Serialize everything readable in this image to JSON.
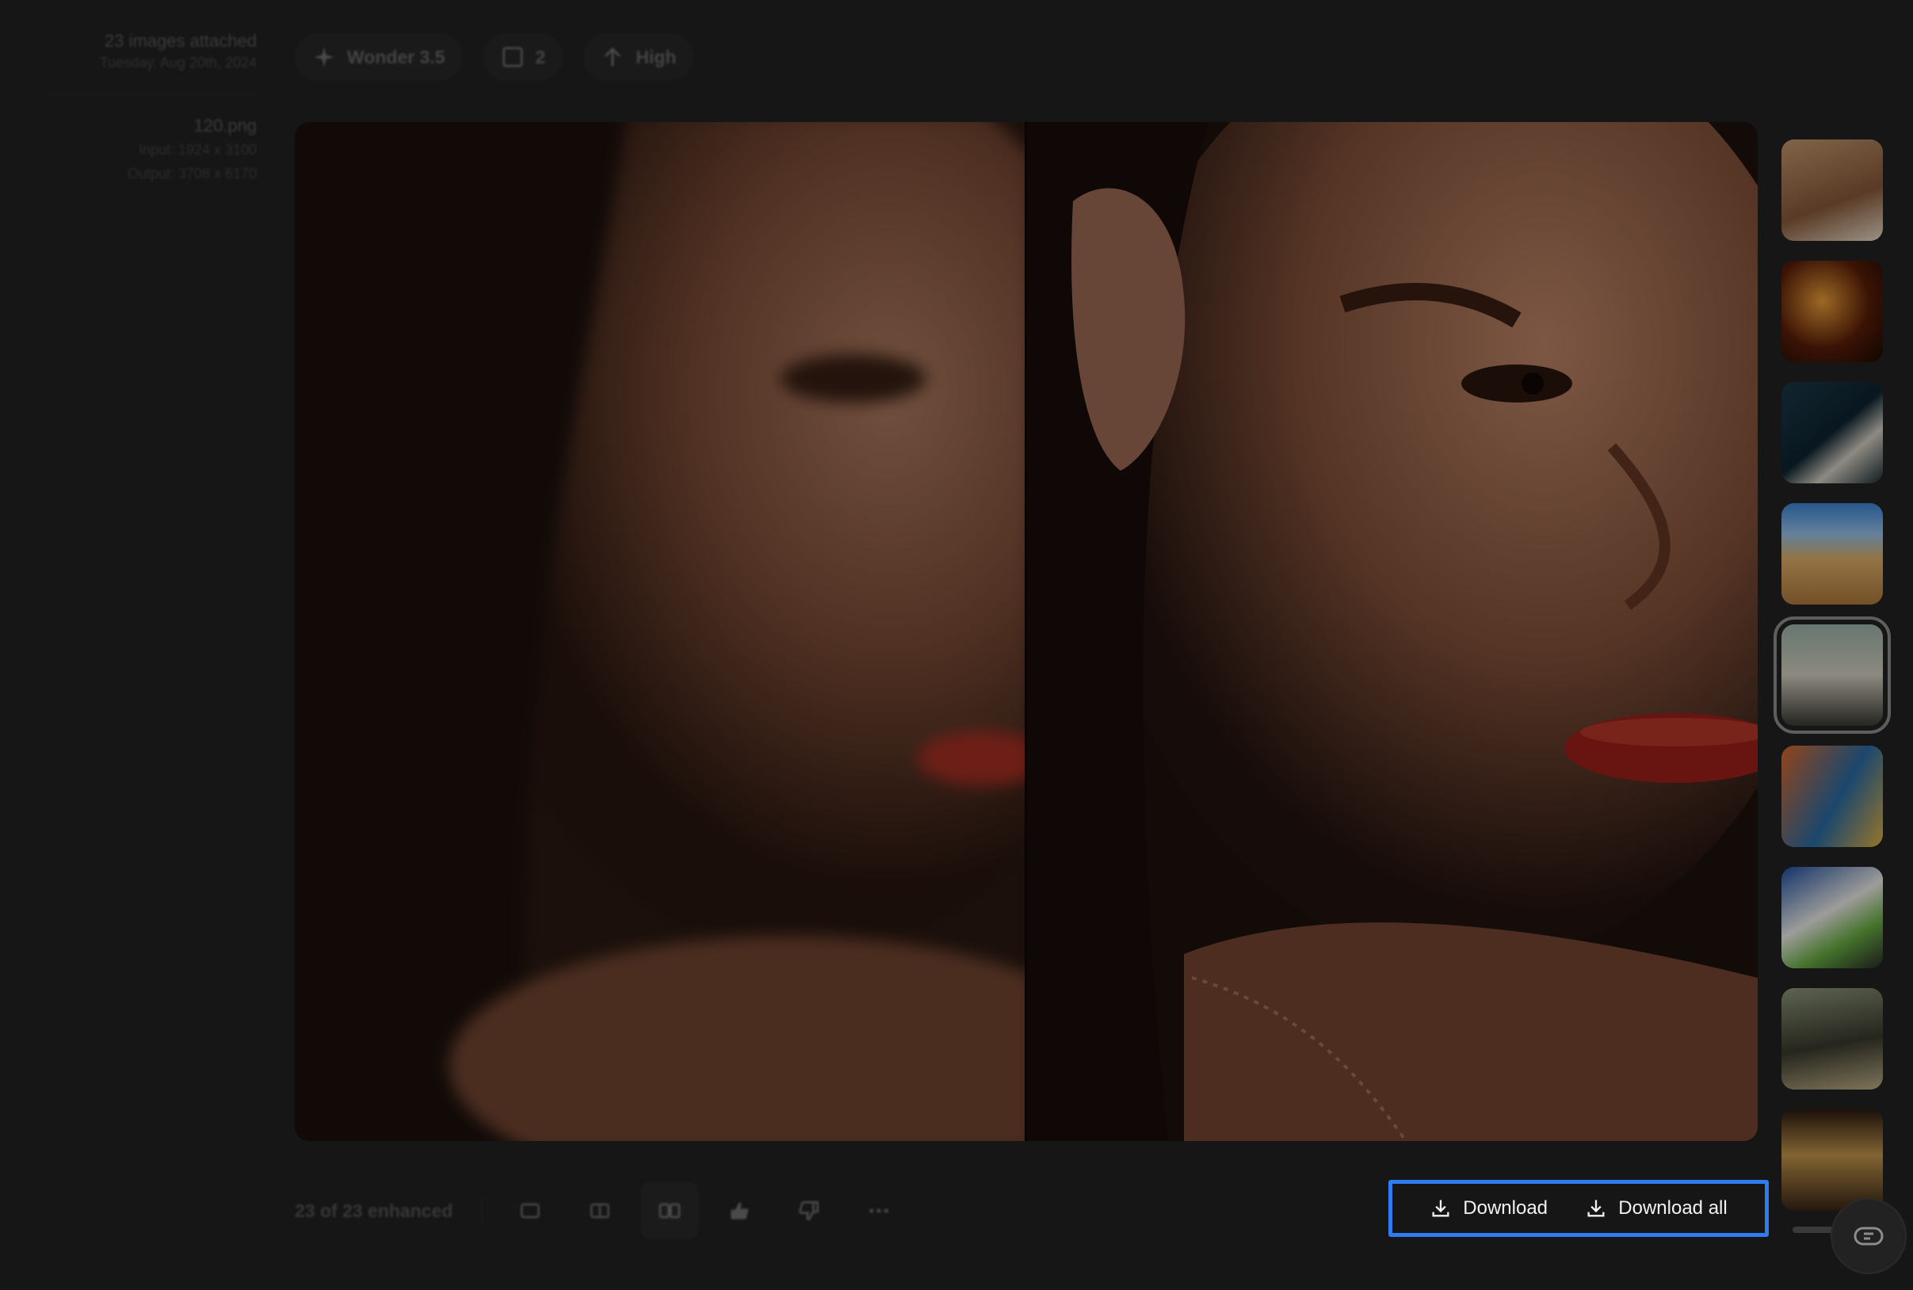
{
  "info": {
    "title": "23 images attached",
    "date": "Tuesday, Aug 20th, 2024",
    "file_name": "120.png",
    "input_size": "Input: 1924 x 3100",
    "output_size": "Output: 3708 x 6170"
  },
  "chips": {
    "model": "Wonder 3.5",
    "scale": "2",
    "quality": "High"
  },
  "toolbar": {
    "status": "23 of 23 enhanced"
  },
  "actions": {
    "download": "Download",
    "download_all": "Download all"
  },
  "icons": {
    "model": "sparkle-icon",
    "scale": "frame-icon",
    "quality": "arrow-up-icon",
    "download": "download-icon",
    "help": "chat-bubble-icon"
  },
  "colors": {
    "highlight": "#2f7bf0",
    "background": "#161616"
  },
  "thumbnails": [
    {
      "label": "thumb-1"
    },
    {
      "label": "thumb-2"
    },
    {
      "label": "thumb-3"
    },
    {
      "label": "thumb-4"
    },
    {
      "label": "thumb-5",
      "active": true
    },
    {
      "label": "thumb-6"
    },
    {
      "label": "thumb-7"
    },
    {
      "label": "thumb-8"
    },
    {
      "label": "thumb-9"
    }
  ]
}
